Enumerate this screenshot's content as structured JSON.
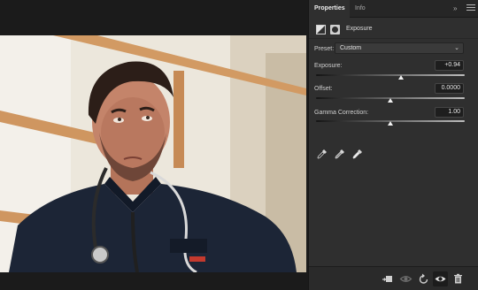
{
  "panel": {
    "tabs": [
      "Properties",
      "Info"
    ],
    "active_tab": "Properties",
    "adjustment_title": "Exposure"
  },
  "preset": {
    "label": "Preset:",
    "value": "Custom"
  },
  "controls": {
    "exposure": {
      "label": "Exposure:",
      "value": "+0.94",
      "slider_fraction": 0.57
    },
    "offset": {
      "label": "Offset:",
      "value": "0.0000",
      "slider_fraction": 0.5
    },
    "gamma": {
      "label": "Gamma Correction:",
      "value": "1.00",
      "slider_fraction": 0.5
    }
  },
  "icons": {
    "eyedroppers": [
      "eyedropper-black-point-icon",
      "eyedropper-gray-point-icon",
      "eyedropper-white-point-icon"
    ],
    "footer": [
      "clip-to-layer-icon",
      "view-previous-state-icon",
      "reset-adjustments-icon",
      "toggle-visibility-icon",
      "delete-adjustment-icon"
    ]
  },
  "colors": {
    "panel_bg": "#2f2f2f",
    "canvas_bg": "#1b1b1b",
    "jacket": "#1c2536",
    "wall_trim": "#d49b62"
  }
}
